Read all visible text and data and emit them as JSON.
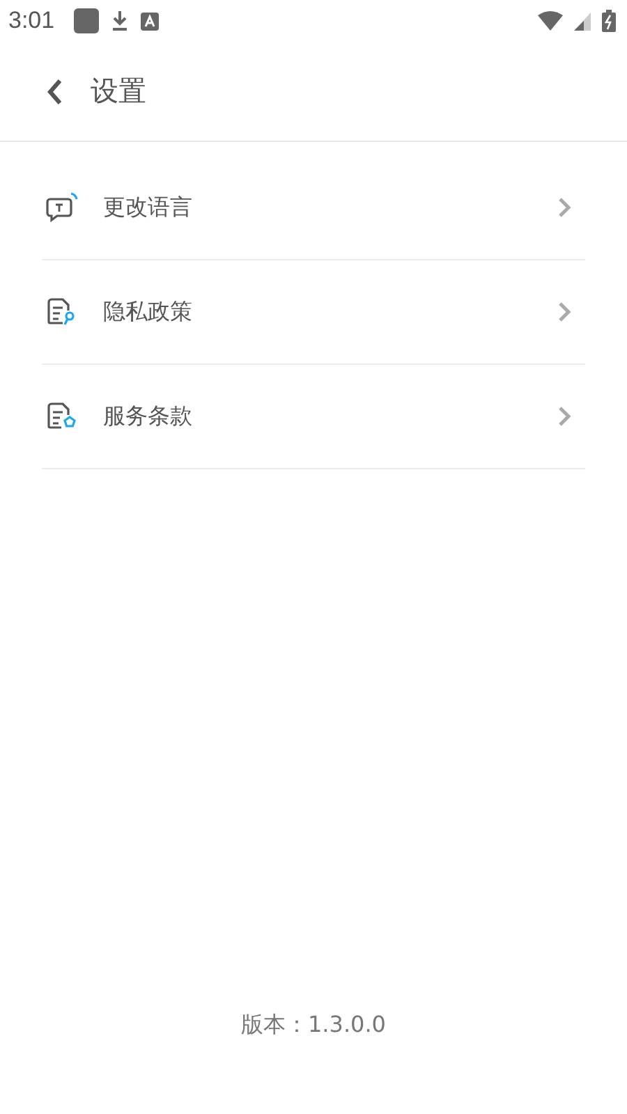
{
  "status_bar": {
    "time": "3:01"
  },
  "header": {
    "title": "设置"
  },
  "items": [
    {
      "kind": "language",
      "label": "更改语言"
    },
    {
      "kind": "privacy",
      "label": "隐私政策"
    },
    {
      "kind": "terms",
      "label": "服务条款"
    }
  ],
  "footer": {
    "version": "版本：1.3.0.0"
  }
}
